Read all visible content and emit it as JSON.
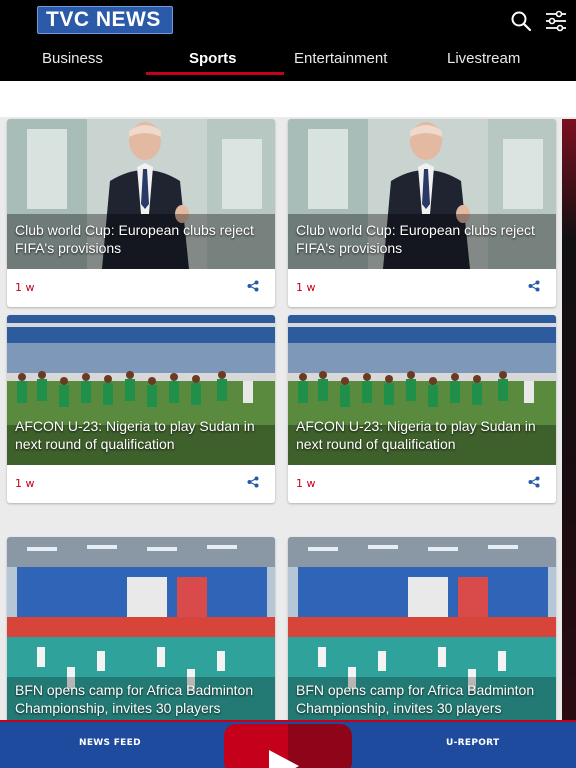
{
  "app": {
    "logo_text": "TVC NEWS"
  },
  "header": {
    "tabs": [
      {
        "label": "Business"
      },
      {
        "label": "Sports"
      },
      {
        "label": "Entertainment"
      },
      {
        "label": "Livestream"
      }
    ],
    "active_tab": "Sports",
    "accent_color": "#c4001b"
  },
  "articles": [
    {
      "title": "Club world Cup: European clubs reject FIFA's provisions",
      "time": "1 w",
      "image_icon": "press-conference-photo"
    },
    {
      "title": "Club world Cup: European clubs reject FIFA's provisions",
      "time": "1 w",
      "image_icon": "press-conference-photo"
    },
    {
      "title": "AFCON U-23: Nigeria to play Sudan in next round of qualification",
      "time": "1 w",
      "image_icon": "football-team-photo"
    },
    {
      "title": "AFCON U-23: Nigeria to play Sudan in next round of qualification",
      "time": "1 w",
      "image_icon": "football-team-photo"
    },
    {
      "title": "BFN opens camp for Africa Badminton Championship, invites 30 players",
      "time": "",
      "image_icon": "badminton-hall-photo"
    },
    {
      "title": "BFN opens camp for Africa Badminton Championship, invites 30 players",
      "time": "",
      "image_icon": "badminton-hall-photo"
    }
  ],
  "bottom_nav": {
    "left_label": "NEWS FEED",
    "right_label": "U-REPORT",
    "center_icon": "play-icon",
    "bar_color": "#1e4b9d"
  }
}
